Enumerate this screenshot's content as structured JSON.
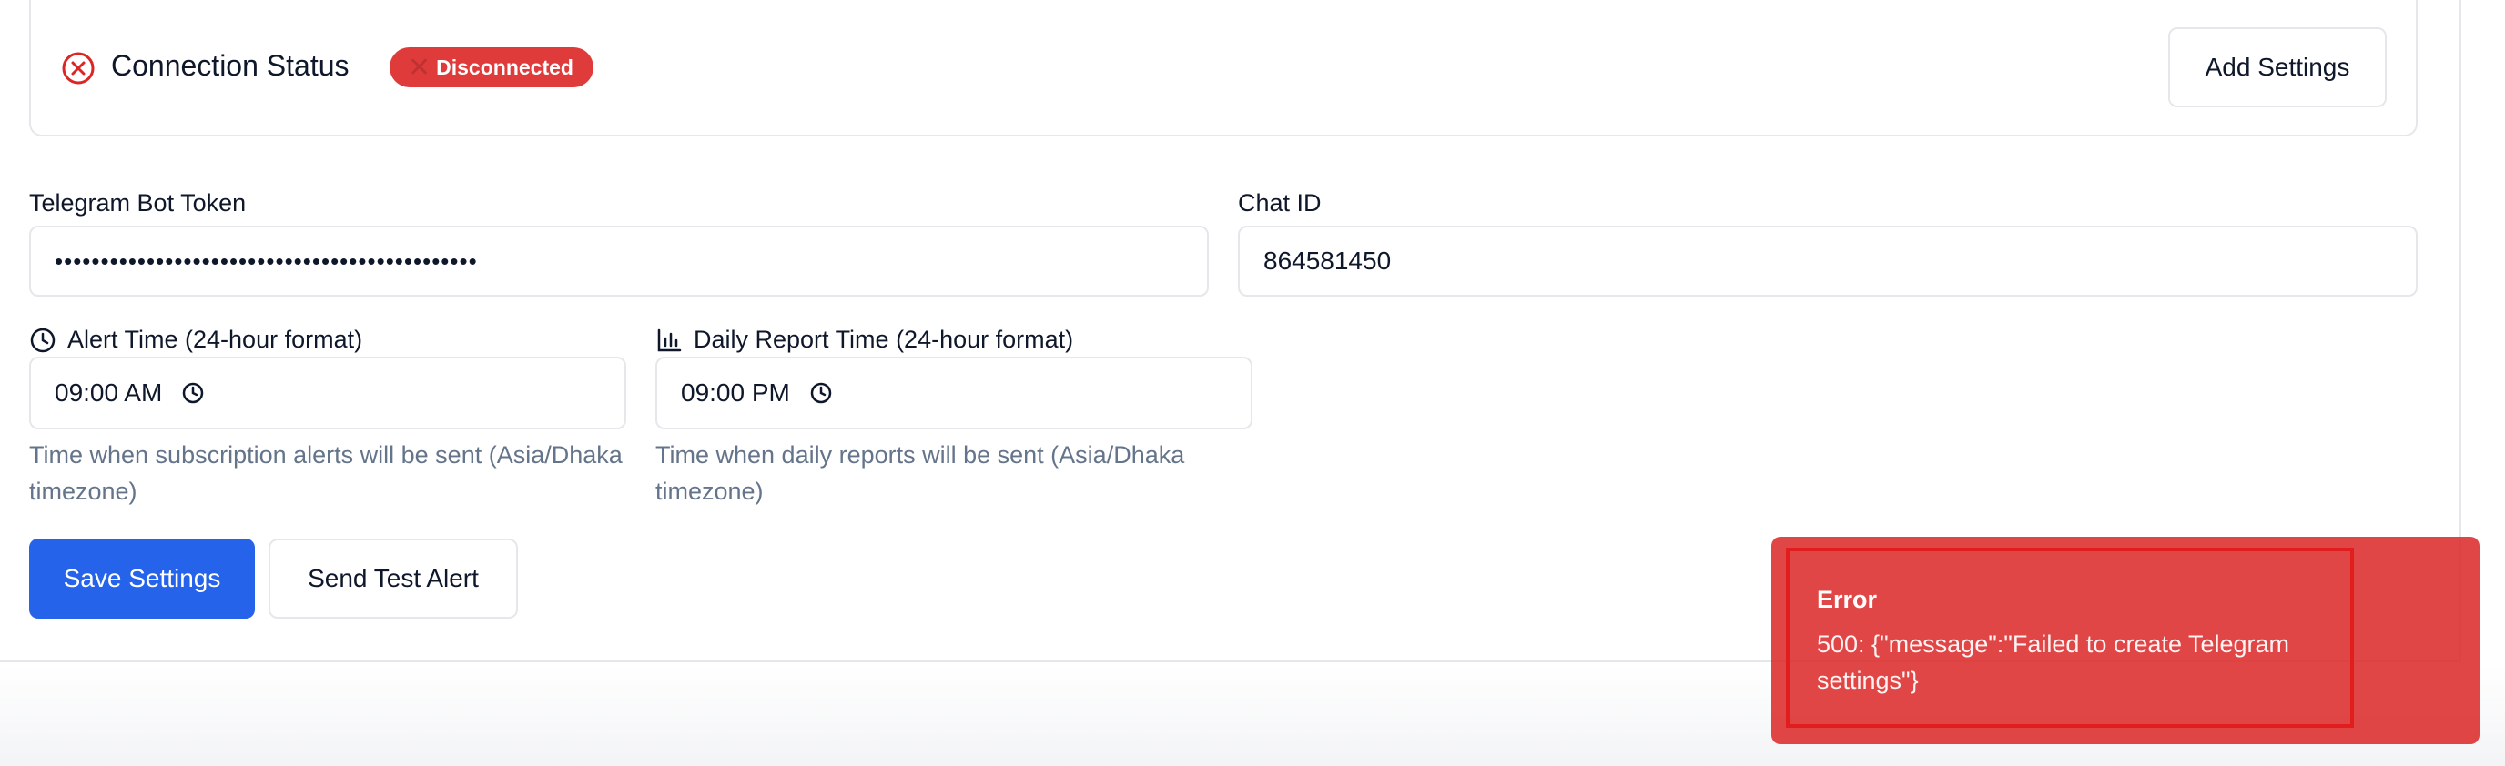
{
  "connection": {
    "title": "Connection Status",
    "status_badge": "Disconnected",
    "add_settings_label": "Add Settings"
  },
  "form": {
    "bot_token": {
      "label": "Telegram Bot Token",
      "value": "••••••••••••••••••••••••••••••••••••••••••••••"
    },
    "chat_id": {
      "label": "Chat ID",
      "value": "864581450"
    },
    "alert_time": {
      "label": "Alert Time (24-hour format)",
      "value": "09:00  AM",
      "help": "Time when subscription alerts will be sent (Asia/Dhaka timezone)"
    },
    "report_time": {
      "label": "Daily Report Time (24-hour format)",
      "value": "09:00  PM",
      "help": "Time when daily reports will be sent (Asia/Dhaka timezone)"
    }
  },
  "actions": {
    "save_label": "Save Settings",
    "test_label": "Send Test Alert"
  },
  "toast": {
    "title": "Error",
    "message": "500: {\"message\":\"Failed to create Telegram settings\"}"
  },
  "colors": {
    "primary": "#2563eb",
    "danger": "#dc2626",
    "muted_text": "#64748b",
    "border": "#e5e7eb"
  },
  "icons": {
    "status": "x-circle-icon",
    "badge": "x-icon",
    "alert_time": "clock-icon",
    "report_time": "bar-chart-icon",
    "time_picker": "clock-icon"
  }
}
